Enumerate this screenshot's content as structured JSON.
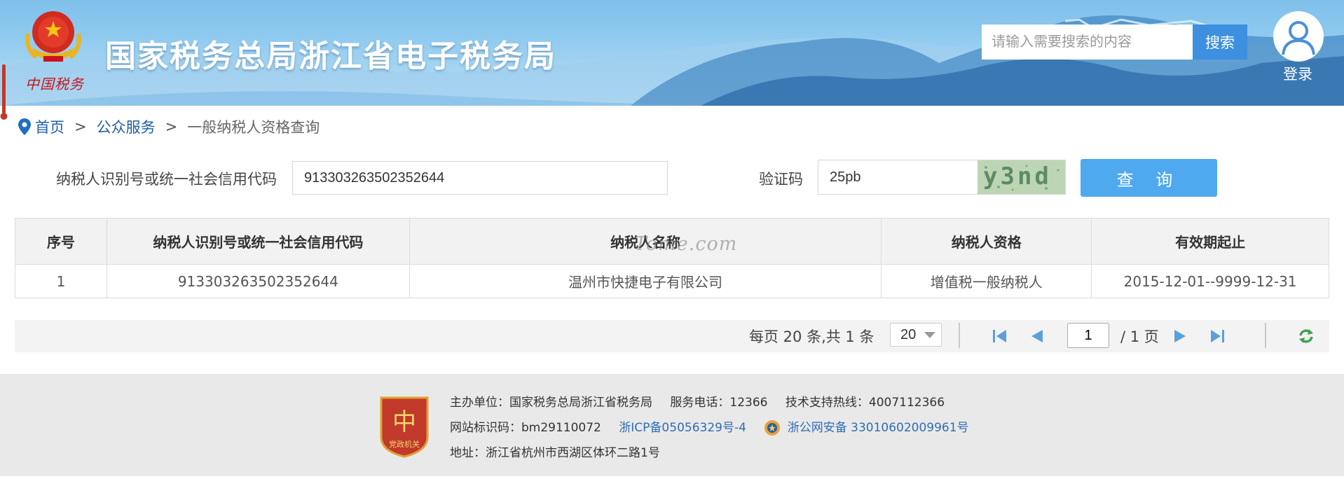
{
  "header": {
    "title": "国家税务总局浙江省电子税务局",
    "emblem_text": "中国税务",
    "search_placeholder": "请输入需要搜索的内容",
    "search_button": "搜索",
    "login_label": "登录",
    "colors": {
      "sky": "#8fcaef",
      "search_button": "#3d8fe0"
    }
  },
  "breadcrumb": {
    "home": "首页",
    "separator": ">",
    "section": "公众服务",
    "current": "一般纳税人资格查询"
  },
  "form": {
    "tax_id_label": "纳税人识别号或统一社会信用代码",
    "tax_id_value": "913303263502352644",
    "captcha_label": "验证码",
    "captcha_value": "25pb",
    "captcha_image_text": "y3nd",
    "query_button": "查 询",
    "colors": {
      "query_button": "#4ea9ef"
    }
  },
  "table": {
    "watermark": "Tome.com",
    "columns": [
      "序号",
      "纳税人识别号或统一社会信用代码",
      "纳税人名称",
      "纳税人资格",
      "有效期起止"
    ],
    "rows": [
      [
        "1",
        "913303263502352644",
        "温州市快捷电子有限公司",
        "增值税一般纳税人",
        "2015-12-01--9999-12-31"
      ]
    ]
  },
  "pager": {
    "info": "每页 20 条,共 1 条",
    "page_size": "20",
    "current_page": "1",
    "total_pages": "/ 1 页",
    "icons": [
      "first-page-icon",
      "prev-page-icon",
      "next-page-icon",
      "last-page-icon",
      "refresh-icon"
    ]
  },
  "footer": {
    "sponsor": "主办单位：国家税务总局浙江省税务局",
    "service_phone": "服务电话：12366",
    "support_hotline": "技术支持热线：4007112366",
    "site_code": "网站标识码：bm29110072",
    "icp": "浙ICP备05056329号-4",
    "police": "浙公网安备 33010602009961号",
    "address": "地址：浙江省杭州市西湖区体环二路1号",
    "badge_text": "党政机关",
    "colors": {
      "link": "#2f6db5",
      "background": "#e9e9e9"
    }
  }
}
